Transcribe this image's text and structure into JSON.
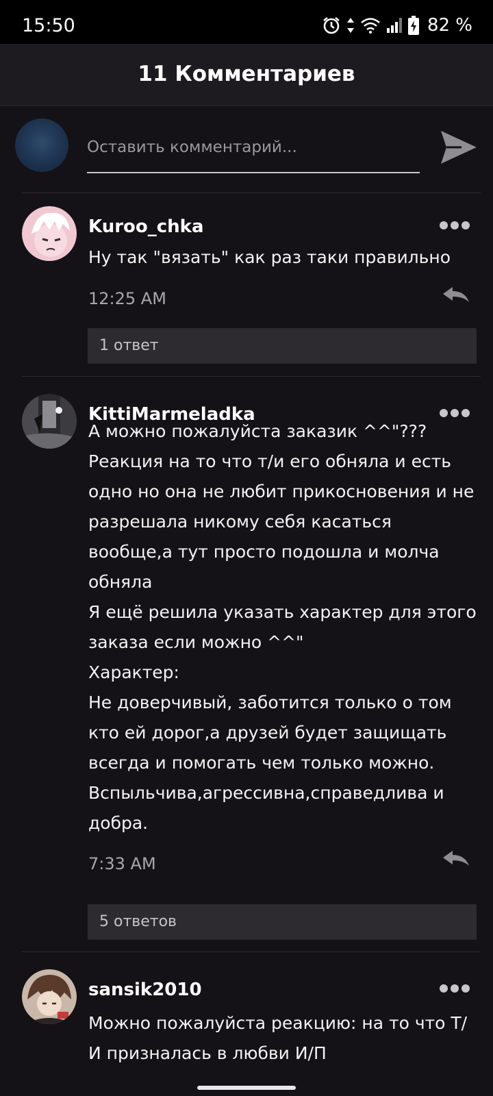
{
  "status_bar": {
    "time": "15:50",
    "battery": "82 %",
    "icons": [
      "alarm-icon",
      "data-arrows-icon",
      "wifi-icon",
      "signal-icon",
      "battery-charging-icon"
    ]
  },
  "header": {
    "title": "11 Комментариев"
  },
  "composer": {
    "placeholder": "Оставить комментарий...",
    "send_icon": "send-icon"
  },
  "comments": [
    {
      "author": "Kuroo_chka",
      "text": "Ну так \"вязать\" как раз таки правильно",
      "time": "12:25 AM",
      "replies": "1 ответ"
    },
    {
      "author": "KittiMarmeladka",
      "text": "А можно пожалуйста заказик ^^\"???\nРеакция на то что т/и его обняла и есть одно но она не любит прикосновения и не разрешала никому себя касаться вообще,а тут просто подошла и молча обняла\nЯ ещё решила указать характер для этого заказа если можно ^^\"\nХарактер:\nНе доверчивый, заботится только о том кто ей дорог,а друзей будет защищать всегда и помогать чем только можно.\nВспыльчива,агрессивна,справедлива и добра.",
      "time": "7:33 AM",
      "replies": "5 ответов"
    },
    {
      "author": "sansik2010",
      "text": "Можно пожалуйста реакцию: на то что Т/И призналась в любви И/П"
    }
  ],
  "colors": {
    "background": "#141216",
    "header": "#1d1b1f",
    "replies_box": "#2d2b2f",
    "muted_text": "#a9a7ac"
  }
}
